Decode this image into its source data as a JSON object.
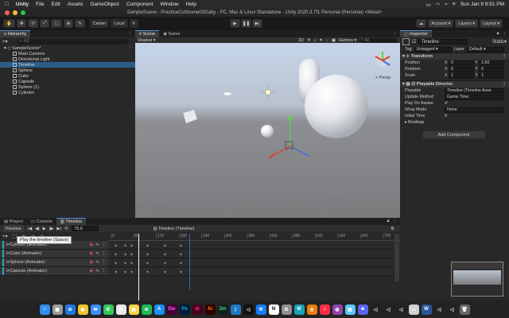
{
  "menubar": {
    "app": "Unity",
    "items": [
      "File",
      "Edit",
      "Assets",
      "GameObject",
      "Component",
      "Window",
      "Help"
    ],
    "clock": "Sun Jan 9  9:51 PM"
  },
  "titlebar": {
    "title": "SampleScene - PracticeCutScene00Gaby - PC, Mac & Linux Standalone - Unity 2020.3.7f1 Personal (Personal) <Metal>"
  },
  "toolbar": {
    "pivot_center": "Center",
    "pivot_local": "Local",
    "account": "Account",
    "layers": "Layers",
    "layout": "Layout"
  },
  "hierarchy": {
    "tab": "Hierarchy",
    "search_placeholder": "All",
    "scene": "SampleScene*",
    "items": [
      "Main Camera",
      "Directional Light",
      "Timeline",
      "Sphere",
      "Cube",
      "Capsule",
      "Sphere (1)",
      "Cylinder"
    ],
    "selected_index": 2
  },
  "scene": {
    "tabs": [
      "Scene",
      "Game"
    ],
    "shading": "Shaded",
    "mode2d": "2D",
    "gizmos": "Gizmos",
    "search_placeholder": "All",
    "persp_label": "< Persp"
  },
  "inspector": {
    "tab": "Inspector",
    "object_name": "Timeline",
    "static_label": "Static",
    "tag_label": "Tag",
    "tag_value": "Untagged",
    "layer_label": "Layer",
    "layer_value": "Default",
    "transform_title": "Transform",
    "position_label": "Position",
    "rotation_label": "Rotation",
    "scale_label": "Scale",
    "position": {
      "x": "0",
      "y": "2.82"
    },
    "rotation": {
      "x": "0",
      "y": "0"
    },
    "scale": {
      "x": "1",
      "y": "1"
    },
    "director_title": "Playable Director",
    "playable_label": "Playable",
    "playable_value": "Timeline (Timeline Asse",
    "update_method_label": "Update Method",
    "update_method_value": "Game Time",
    "play_on_awake_label": "Play On Awake",
    "wrap_mode_label": "Wrap Mode",
    "wrap_mode_value": "None",
    "initial_time_label": "Initial Time",
    "initial_time_value": "0",
    "bindings_label": "Bindings",
    "add_component": "Add Component"
  },
  "timeline": {
    "tabs": [
      "Project",
      "Console",
      "Timeline"
    ],
    "preview": "Preview",
    "frame": "75.6",
    "asset_name": "Timeline (Timeline)",
    "ruler": [
      "0",
      "60",
      "120",
      "180",
      "240",
      "300",
      "360",
      "420",
      "480",
      "540",
      "600",
      "660",
      "720"
    ],
    "tracks": [
      "Cylinder (Animator)",
      "Cube (Animator)",
      "Sphere (Animator)",
      "Capsule (Animator)"
    ],
    "tooltip": "Play the timeline (Space)",
    "playhead_fraction": 0.105
  },
  "dock": {
    "icons": [
      "finder",
      "launchpad",
      "safari",
      "chrome",
      "mail",
      "messages",
      "photos",
      "notes",
      "spotify",
      "appstore",
      "dreamweaver",
      "photoshop",
      "indesign",
      "illustrator",
      "dimension",
      "vscode",
      "unity-hub",
      "xcode",
      "notion",
      "settings",
      "mixamo",
      "blender",
      "music",
      "podcasts",
      "preview",
      "discord",
      "unity",
      "unity",
      "unity",
      "files",
      "word",
      "unity",
      "unity",
      "trash"
    ]
  },
  "colors": {
    "accent": "#4e8bd6",
    "selection": "#2c5d87",
    "track": "#2fa6c8"
  }
}
